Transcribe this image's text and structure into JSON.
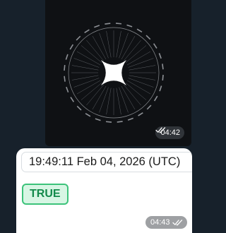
{
  "media_message": {
    "time": "04:42",
    "status_icon": "double-check-icon"
  },
  "text_message": {
    "timestamp_text": "19:49:11 Feb 04, 2026 (UTC)",
    "badge_text": "TRUE",
    "time": "04:43",
    "status_icon": "double-check-icon"
  },
  "colors": {
    "chat_background": "#17212b",
    "bubble_background": "#ffffff",
    "badge_border": "#3cc37a",
    "badge_fill": "#d7f6e4",
    "badge_text": "#138a4b"
  }
}
